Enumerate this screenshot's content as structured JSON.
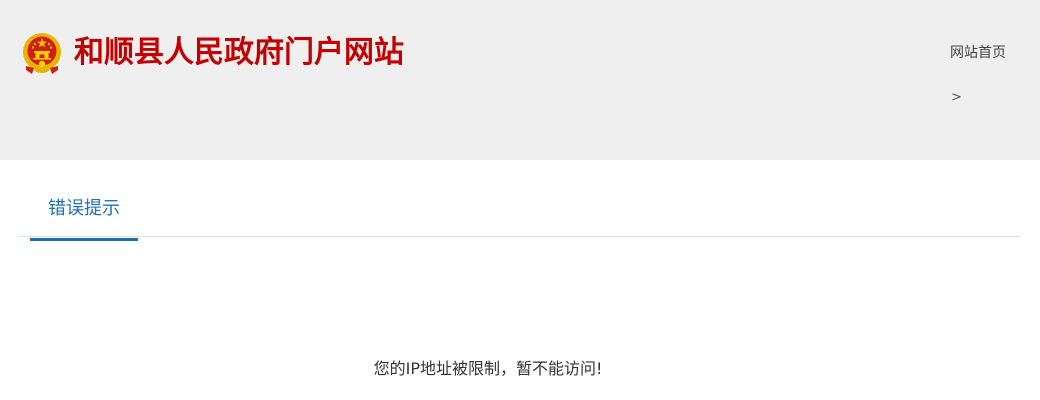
{
  "header": {
    "site_title": "和顺县人民政府门户网站",
    "home_link": "网站首页",
    "breadcrumb_separator": ">"
  },
  "tabs": [
    {
      "label": "错误提示",
      "active": true
    }
  ],
  "main": {
    "message": "您的IP地址被限制，暂不能访问!"
  },
  "colors": {
    "title_red": "#c40000",
    "accent_blue": "#1d6fb8",
    "header_bg": "#efefef",
    "emblem_gold": "#e8b400",
    "emblem_red": "#d21f12"
  },
  "icons": {
    "emblem": "national-emblem-icon"
  }
}
